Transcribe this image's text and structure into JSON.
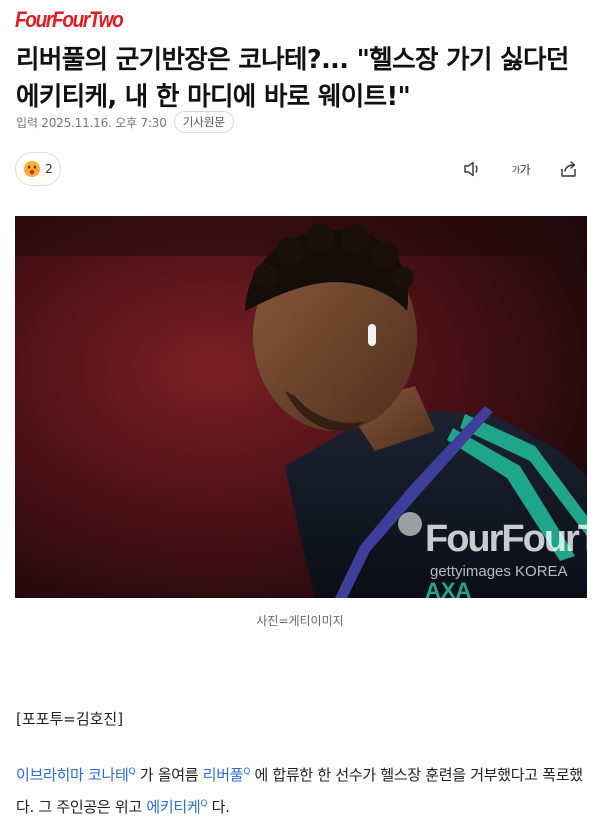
{
  "brand": {
    "logo_text": "FourFourTwo",
    "accent": "#e41b23"
  },
  "article": {
    "headline": "리버풀의 군기반장은 코나테?... \"헬스장 가기 싫다던 에키티케, 내 한 마디에 바로 웨이트!\"",
    "date": "입력 2025.11.16. 오후 7:30",
    "origin_button": "기사원문"
  },
  "reaction": {
    "count": "2",
    "emoji": "surprised-face-icon"
  },
  "toolbar": {
    "listen_icon": "speaker-icon",
    "fontsize_label_small": "가",
    "fontsize_label_big": "가",
    "share_icon": "share-icon"
  },
  "photo": {
    "watermark_brand": "FourFourTwo",
    "watermark_credit": "gettyimages KOREA",
    "shirt_sponsor": "AXA",
    "caption": "사진=게티이미지"
  },
  "body": {
    "byline": "[포포투=김호진]",
    "p1_link1": "이브라히마 코나테",
    "p1_text1": " 가 올여름 ",
    "p1_link2": "리버풀",
    "p1_text2": " 에 합류한 한 선수가 헬스장 훈련을 거부했다고 폭로했다. 그 주인공은 위고 ",
    "p1_link3": "에키티케",
    "p1_text3": " 다.",
    "link_mark": "Q"
  }
}
